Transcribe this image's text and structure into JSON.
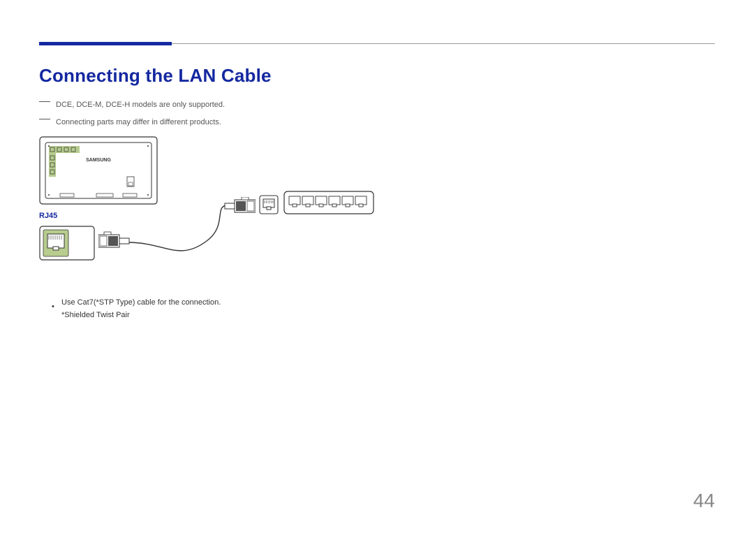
{
  "header": {
    "title": "Connecting the LAN Cable"
  },
  "notes": {
    "line1": "DCE, DCE-M, DCE-H models are only supported.",
    "line2": "Connecting parts may differ in different products."
  },
  "diagram": {
    "port_label": "RJ45",
    "device_brand": "SAMSUNG"
  },
  "bullets": {
    "b1_line1": "Use Cat7(*STP Type) cable for the connection.",
    "b1_line2": "*Shielded Twist Pair"
  },
  "footer": {
    "page_number": "44"
  }
}
